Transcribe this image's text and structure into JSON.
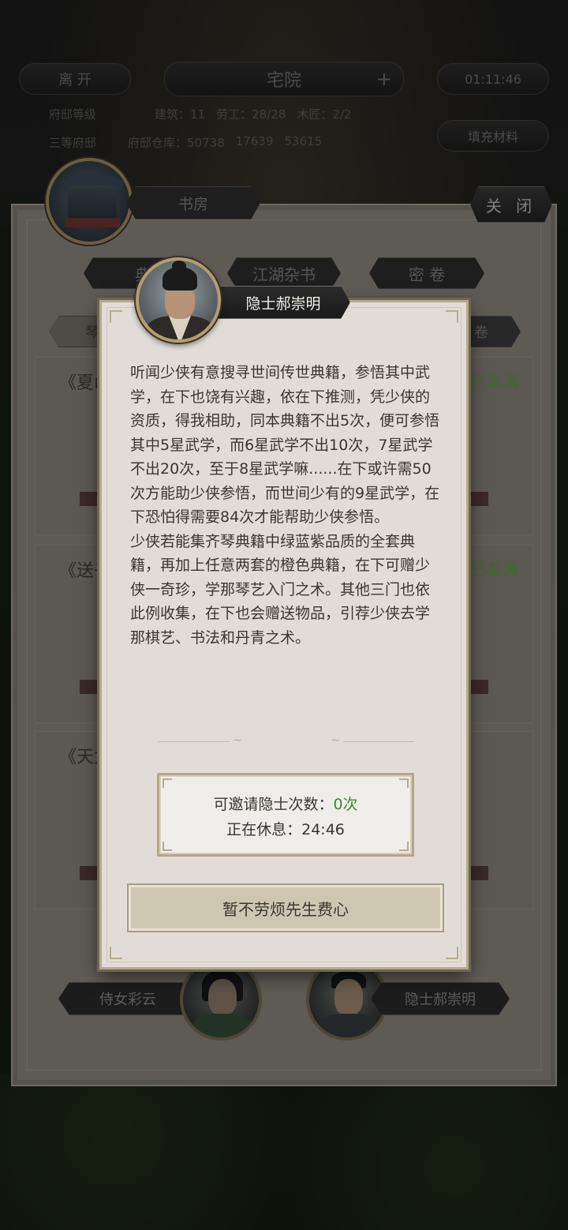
{
  "hud": {
    "leave_label": "离 开",
    "location_title": "宅院",
    "plus_symbol": "+",
    "timer": "01:11:46",
    "row1": [
      "府邸等级",
      "建筑：11",
      "劳工：28/28",
      "木匠：2/2"
    ],
    "row2": [
      "三等府邸",
      "府邸仓库：50738",
      "17639",
      "53615"
    ],
    "fill_materials_label": "填充材料"
  },
  "panel": {
    "room_title": "书房",
    "close_label": "关 闭",
    "tabs": [
      "典",
      "江湖杂书",
      "密 卷"
    ],
    "sub_tabs": [
      "琴",
      "卷"
    ],
    "books": [
      {
        "title": "《夏山",
        "status": "已集满"
      },
      {
        "title": "《送子",
        "status": "已集满"
      },
      {
        "title": "《天女",
        "status": ""
      }
    ],
    "npcs": [
      {
        "label": "侍女彩云"
      },
      {
        "label": "隐士郝崇明"
      }
    ]
  },
  "dialog": {
    "name": "隐士郝崇明",
    "paragraph1": "听闻少侠有意搜寻世间传世典籍，参悟其中武学，在下也饶有兴趣，依在下推测，凭少侠的资质，得我相助，同本典籍不出5次，便可参悟其中5星武学，而6星武学不出10次，7星武学不出20次，至于8星武学嘛......在下或许需50次方能助少侠参悟，而世间少有的9星武学，在下恐怕得需要84次才能帮助少侠参悟。",
    "paragraph2": "少侠若能集齐琴典籍中绿蓝紫品质的全套典籍，再加上任意两套的橙色典籍，在下可赠少侠一奇珍，学那琴艺入门之术。其他三门也依此例收集，在下也会赠送物品，引荐少侠去学那棋艺、书法和丹青之术。",
    "invite_label": "可邀请隐士次数：",
    "invite_count": "0次",
    "rest_label": "正在休息：",
    "rest_timer": "24:46",
    "dismiss_label": "暂不劳烦先生费心"
  },
  "colors": {
    "dialog_bg": "#e1ddd6",
    "accent_green": "#3e8a2c",
    "frame_gold": "#b3a68a"
  }
}
